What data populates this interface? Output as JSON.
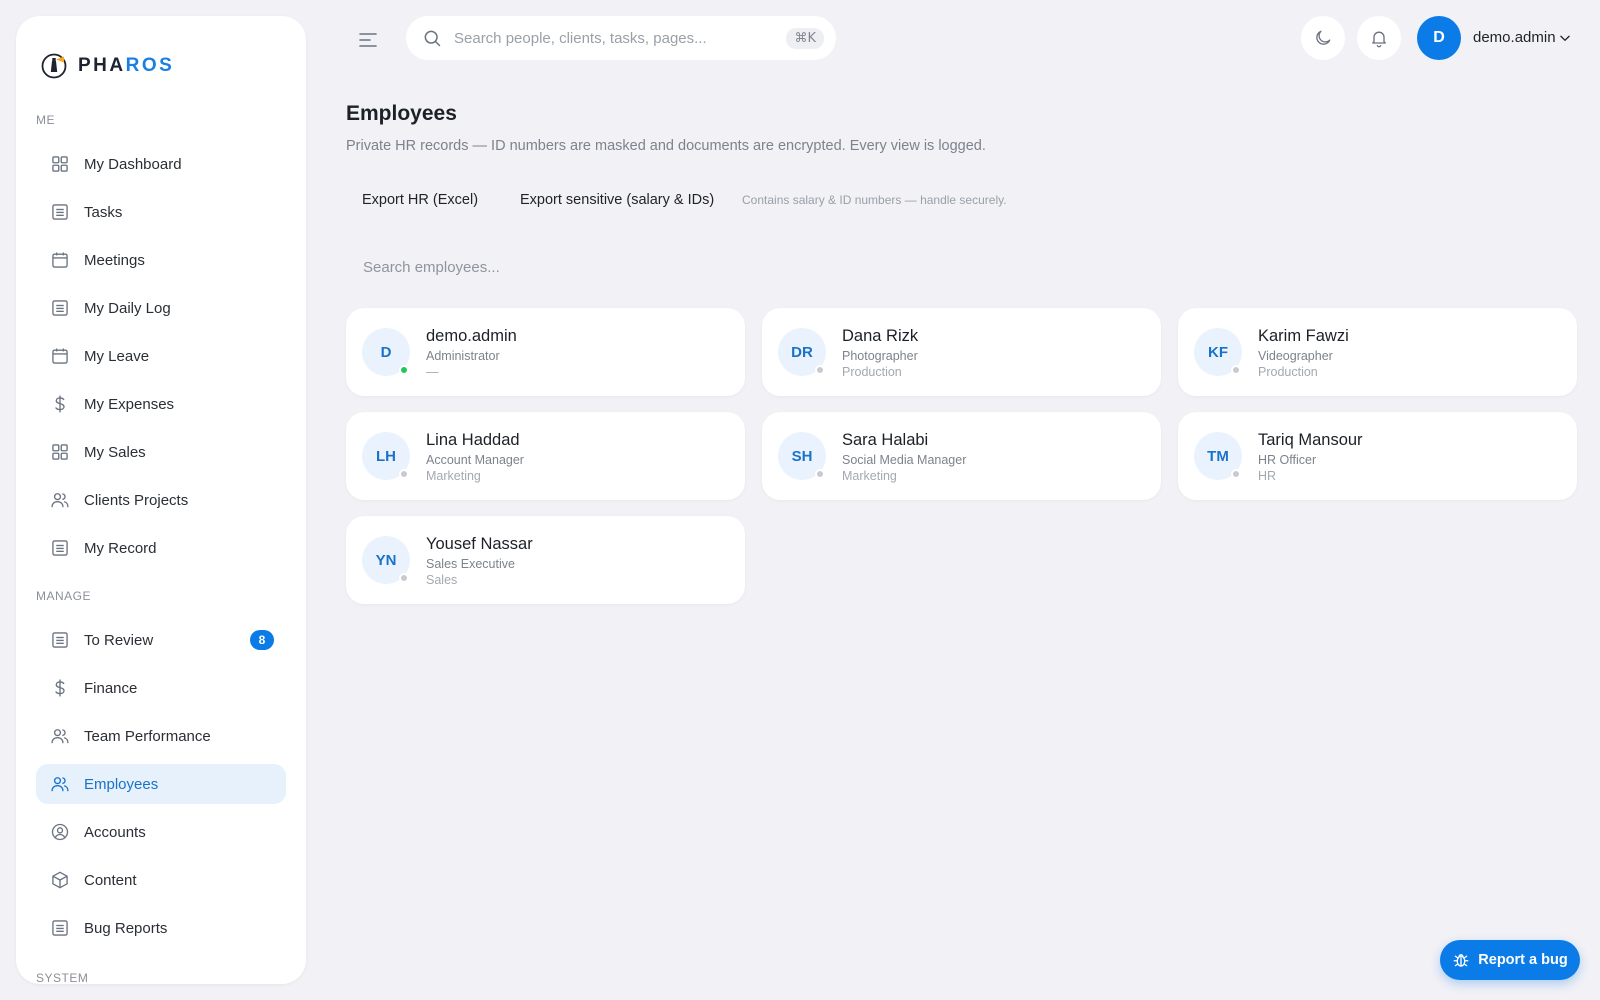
{
  "brand": {
    "name_a": "PHA",
    "name_b": "ROS"
  },
  "sidebar": {
    "sections": {
      "me": "ME",
      "manage": "MANAGE",
      "system": "SYSTEM"
    },
    "me_items": [
      {
        "label": "My Dashboard",
        "icon": "grid-icon"
      },
      {
        "label": "Tasks",
        "icon": "document-icon"
      },
      {
        "label": "Meetings",
        "icon": "calendar-icon"
      },
      {
        "label": "My Daily Log",
        "icon": "document-icon"
      },
      {
        "label": "My Leave",
        "icon": "calendar-icon"
      },
      {
        "label": "My Expenses",
        "icon": "dollar-icon"
      },
      {
        "label": "My Sales",
        "icon": "grid-icon"
      },
      {
        "label": "Clients Projects",
        "icon": "users-icon"
      },
      {
        "label": "My Record",
        "icon": "document-icon"
      }
    ],
    "manage_items": [
      {
        "label": "To Review",
        "icon": "document-icon",
        "badge": "8"
      },
      {
        "label": "Finance",
        "icon": "dollar-icon"
      },
      {
        "label": "Team Performance",
        "icon": "users-icon"
      },
      {
        "label": "Employees",
        "icon": "users-icon",
        "active": true
      },
      {
        "label": "Accounts",
        "icon": "user-circle-icon"
      },
      {
        "label": "Content",
        "icon": "box-icon"
      },
      {
        "label": "Bug Reports",
        "icon": "document-icon"
      }
    ]
  },
  "topbar": {
    "search_placeholder": "Search people, clients, tasks, pages...",
    "shortcut": "⌘K",
    "avatar_initial": "D",
    "user_name": "demo.admin"
  },
  "main": {
    "title": "Employees",
    "subtitle": "Private HR records — ID numbers are masked and documents are encrypted. Every view is logged.",
    "export_hr": "Export HR (Excel)",
    "export_sensitive": "Export sensitive (salary & IDs)",
    "sensitive_note": "Contains salary & ID numbers — handle securely.",
    "search_placeholder": "Search employees...",
    "employees": [
      {
        "initials": "D",
        "name": "demo.admin",
        "role": "Administrator",
        "dept": "—",
        "online": true
      },
      {
        "initials": "DR",
        "name": "Dana Rizk",
        "role": "Photographer",
        "dept": "Production",
        "online": false
      },
      {
        "initials": "KF",
        "name": "Karim Fawzi",
        "role": "Videographer",
        "dept": "Production",
        "online": false
      },
      {
        "initials": "LH",
        "name": "Lina Haddad",
        "role": "Account Manager",
        "dept": "Marketing",
        "online": false
      },
      {
        "initials": "SH",
        "name": "Sara Halabi",
        "role": "Social Media Manager",
        "dept": "Marketing",
        "online": false
      },
      {
        "initials": "TM",
        "name": "Tariq Mansour",
        "role": "HR Officer",
        "dept": "HR",
        "online": false
      },
      {
        "initials": "YN",
        "name": "Yousef Nassar",
        "role": "Sales Executive",
        "dept": "Sales",
        "online": false
      }
    ]
  },
  "bug_button": {
    "label": "Report a bug"
  },
  "colors": {
    "accent": "#0b7be8",
    "active_bg": "#e6f1fc",
    "online": "#22c55e",
    "page_bg": "#f1f1f6"
  }
}
